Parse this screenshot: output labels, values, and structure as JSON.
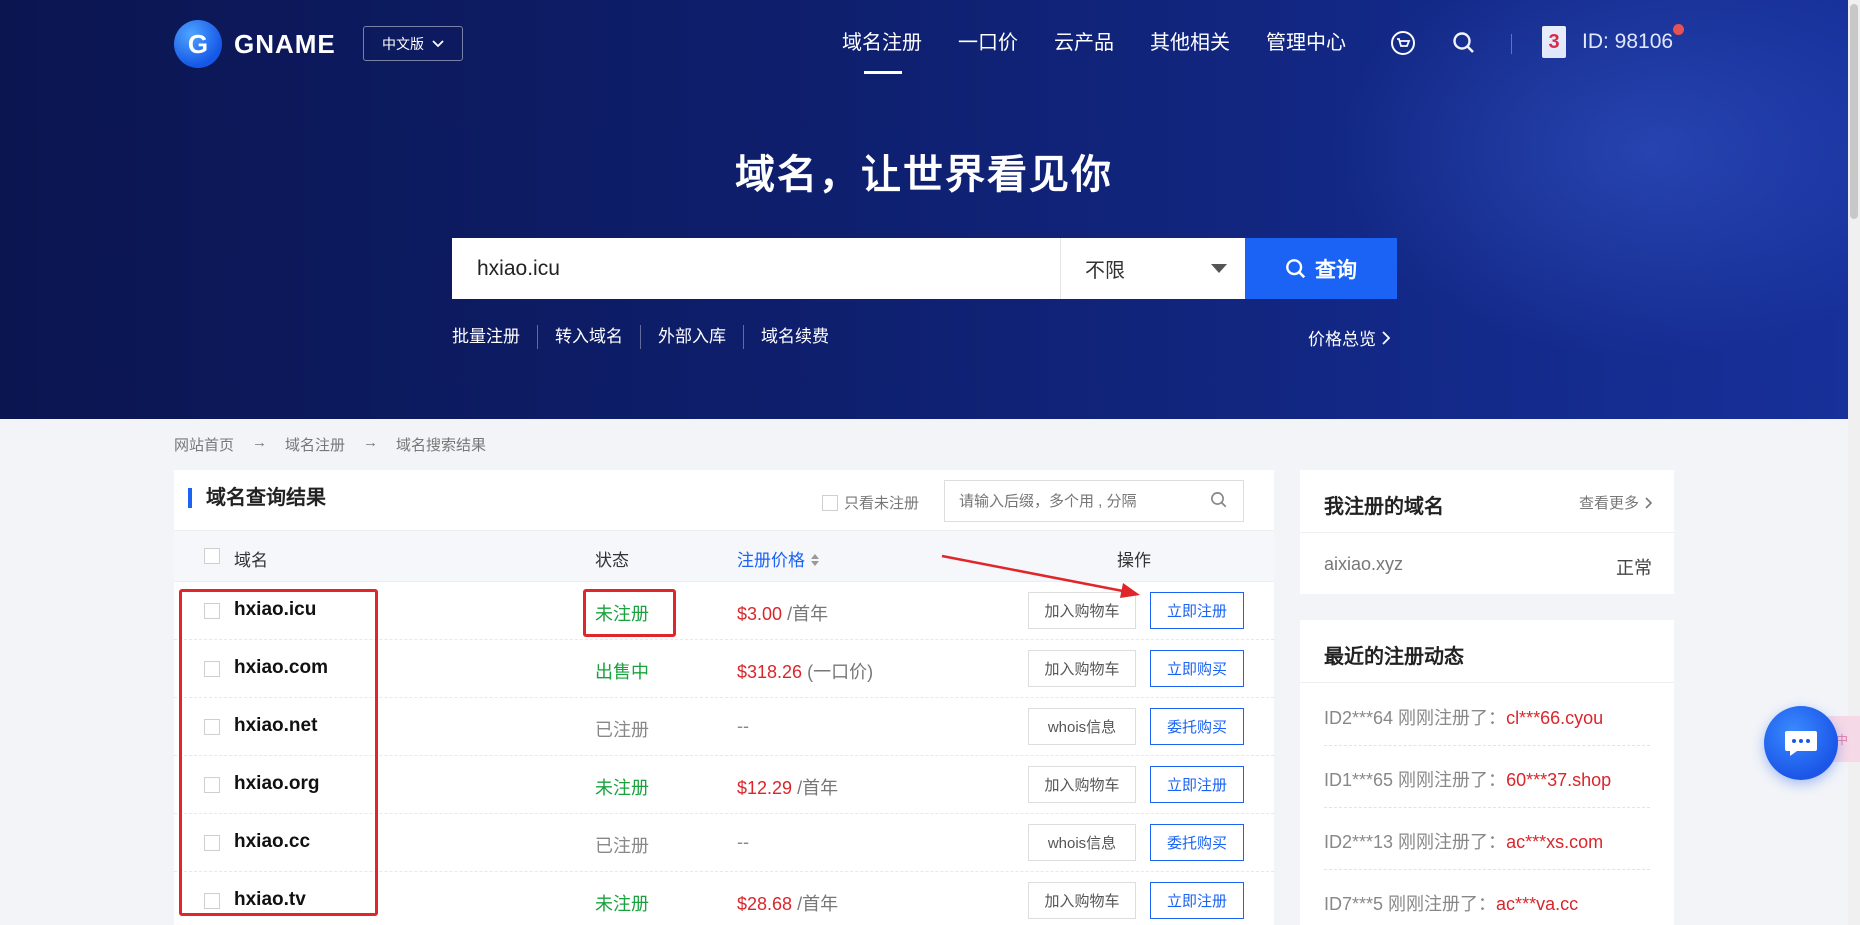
{
  "header": {
    "logo_text": "GNAME",
    "logo_letter": "G",
    "lang": "中文版",
    "nav": [
      "域名注册",
      "一口价",
      "云产品",
      "其他相关",
      "管理中心"
    ],
    "user_badge": "3",
    "user_id": "ID: 98106"
  },
  "hero": {
    "title": "域名，让世界看见你",
    "search_value": "hxiao.icu",
    "select_value": "不限",
    "search_btn": "查询",
    "sub_links": [
      "批量注册",
      "转入域名",
      "外部入库",
      "域名续费"
    ],
    "price_overview": "价格总览"
  },
  "breadcrumb": [
    "网站首页",
    "域名注册",
    "域名搜索结果"
  ],
  "results": {
    "title": "域名查询结果",
    "only_unregistered": "只看未注册",
    "filter_placeholder": "请输入后缀，多个用 , 分隔",
    "columns": {
      "domain": "域名",
      "status": "状态",
      "price": "注册价格",
      "action": "操作"
    },
    "rows": [
      {
        "domain": "hxiao.icu",
        "status": "未注册",
        "price": "$3.00",
        "unit": "/首年",
        "btn1": "加入购物车",
        "btn2": "立即注册"
      },
      {
        "domain": "hxiao.com",
        "status": "出售中",
        "price": "$318.26",
        "unit": "(一口价)",
        "btn1": "加入购物车",
        "btn2": "立即购买"
      },
      {
        "domain": "hxiao.net",
        "status": "已注册",
        "price": "--",
        "unit": "",
        "btn1": "whois信息",
        "btn2": "委托购买"
      },
      {
        "domain": "hxiao.org",
        "status": "未注册",
        "price": "$12.29",
        "unit": "/首年",
        "btn1": "加入购物车",
        "btn2": "立即注册"
      },
      {
        "domain": "hxiao.cc",
        "status": "已注册",
        "price": "--",
        "unit": "",
        "btn1": "whois信息",
        "btn2": "委托购买"
      },
      {
        "domain": "hxiao.tv",
        "status": "未注册",
        "price": "$28.68",
        "unit": "/首年",
        "btn1": "加入购物车",
        "btn2": "立即注册"
      }
    ]
  },
  "my_domains": {
    "title": "我注册的域名",
    "more": "查看更多",
    "domain": "aixiao.xyz",
    "status": "正常"
  },
  "recent": {
    "title": "最近的注册动态",
    "items": [
      {
        "prefix": "ID2***64 刚刚注册了：",
        "domain": "cl***66.cyou"
      },
      {
        "prefix": "ID1***65 刚刚注册了：",
        "domain": "60***37.shop"
      },
      {
        "prefix": "ID2***13 刚刚注册了：",
        "domain": "ac***xs.com"
      },
      {
        "prefix": "ID7***5 刚刚注册了：",
        "domain": "ac***va.cc"
      }
    ]
  },
  "colors": {
    "accent": "#1a63f5",
    "green": "#19a23d",
    "red": "#d9262b",
    "hero_dark": "#0b1550"
  },
  "chat_tab_text": "中"
}
